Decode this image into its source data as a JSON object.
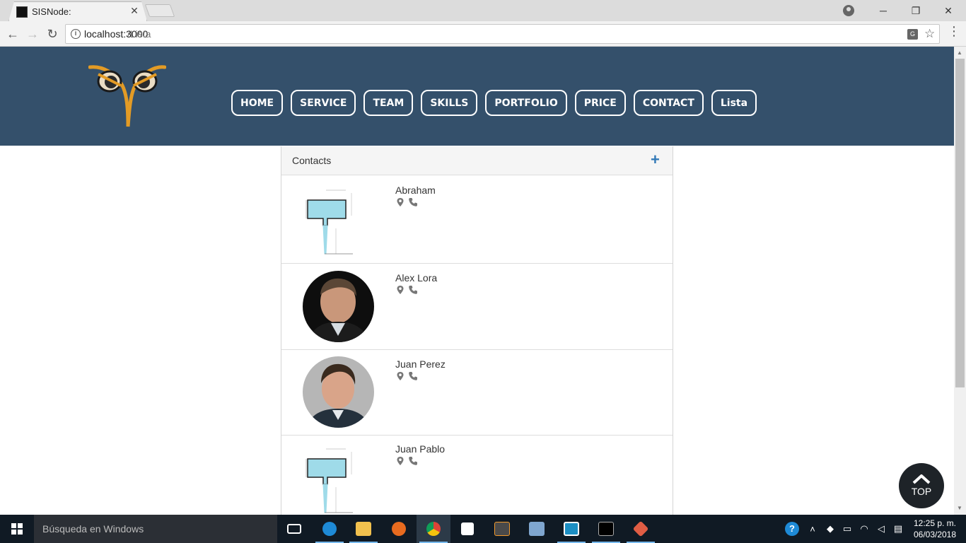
{
  "browser": {
    "tab_title": "SISNode:",
    "tab_close": "✕",
    "url_host": "localhost:3000",
    "url_path": "/Lista"
  },
  "header": {
    "nav": [
      "HOME",
      "SERVICE",
      "TEAM",
      "SKILLS",
      "PORTFOLIO",
      "PRICE",
      "CONTACT",
      "Lista"
    ]
  },
  "contacts": {
    "title": "Contacts",
    "add_label": "+",
    "items": [
      {
        "name": "Abraham",
        "avatar": "sign-diagram"
      },
      {
        "name": "Alex Lora",
        "avatar": "photo-man-1"
      },
      {
        "name": "Juan Perez",
        "avatar": "photo-man-2"
      },
      {
        "name": "Juan Pablo",
        "avatar": "sign-diagram"
      }
    ]
  },
  "top_button": {
    "label": "TOP"
  },
  "taskbar": {
    "search_placeholder": "Búsqueda en Windows",
    "clock_time": "12:25 p. m.",
    "clock_date": "06/03/2018"
  }
}
